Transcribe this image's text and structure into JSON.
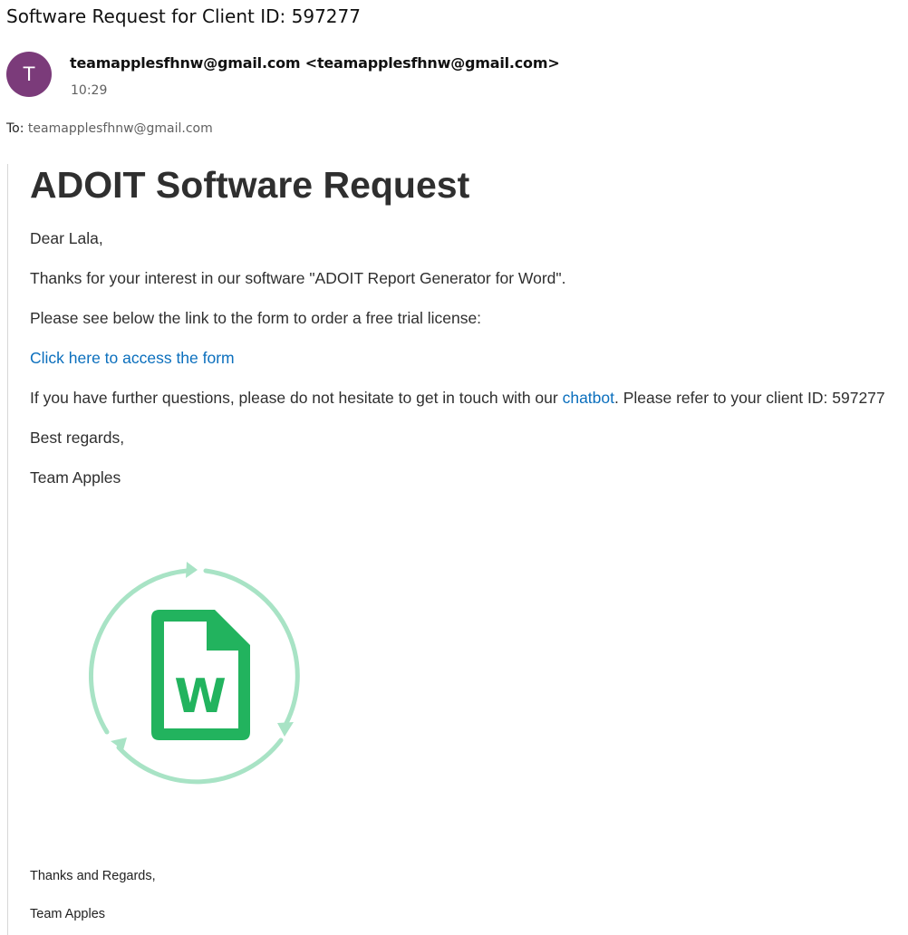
{
  "email": {
    "subject": "Software Request for Client ID: 597277",
    "sender": {
      "avatar_initial": "T",
      "display": "teamapplesfhnw@gmail.com <teamapplesfhnw@gmail.com>",
      "time": "10:29",
      "avatar_color": "#7b3b7a"
    },
    "recipients": {
      "label": "To:",
      "value": "teamapplesfhnw@gmail.com"
    }
  },
  "message": {
    "heading": "ADOIT Software Request",
    "greeting": "Dear Lala,",
    "line_interest": "Thanks for your interest in our software \"ADOIT Report Generator for Word\".",
    "line_form_intro": "Please see below the link to the form to order a free trial license:",
    "form_link": "Click here to access the form",
    "questions_before": "If you have further questions, please do not hesitate to get in touch with our ",
    "chatbot_link": "chatbot",
    "questions_after": ". Please refer to your client ID: 597277",
    "closing": "Best regards,",
    "signature": "Team Apples",
    "logo_letter": "W",
    "logo_icon": "word-document-sync-icon",
    "footer_closing": "Thanks and Regards,",
    "footer_signature": "Team Apples",
    "colors": {
      "link": "#0b6fbd",
      "logo_green": "#22b35e",
      "logo_ring": "#a8e3c5"
    }
  }
}
